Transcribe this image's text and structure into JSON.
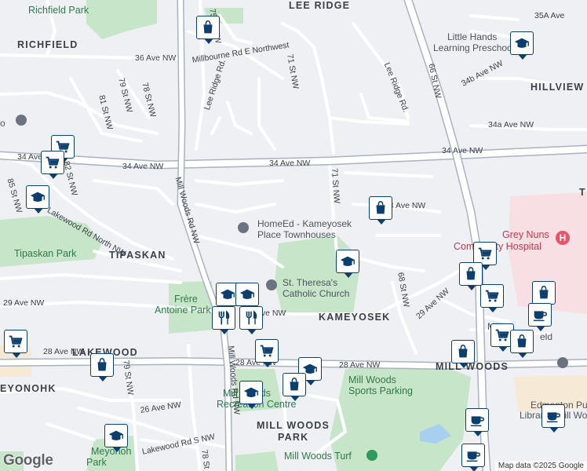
{
  "map": {
    "attribution": "Map data ©2025 Google",
    "logo": "Google",
    "neighbourhoods": [
      "LEE RIDGE",
      "RICHFIELD",
      "HILLVIEW",
      "TIPASKAN",
      "KAMEYOSEK",
      "MILL WOODS",
      "EYONOHK",
      "LAKEWOOD",
      "MILL WOODS",
      "PARK",
      "T"
    ],
    "parks": [
      "Richfield Park",
      "Tipaskan Park",
      "Frère",
      "Antoine Park",
      "Mill Woods",
      "Recreation Centre",
      "Meyonoh",
      "Park",
      "Mill Woods Turf",
      "Mill Woods",
      "Sports Parking"
    ],
    "streets": [
      "35A Ave",
      "36 Ave NW",
      "Millbourne Rd E Northwest",
      "75 St NW",
      "Lee Ridge Rd.",
      "71 St NW",
      "Lee Ridge Rd.",
      "66 St NW",
      "34b Ave NW",
      "34a Ave NW",
      "81 St NW",
      "79 St NW",
      "78 St NW",
      "34 Ave NW",
      "34 Ave NW",
      "34 Ave NW",
      "34 Ave NW",
      "85 St NW",
      "82 St NW",
      "Lakewood Rd North NW",
      "Mill Woods Rd NW",
      "71 St NW",
      "34 Ave NW",
      "68 St NW",
      "29 Ave NW",
      "29 Ave NW",
      "29 Ave NW",
      "28 Ave NW",
      "28 Ave NW",
      "28 Ave NW",
      "79 St NW",
      "26 Ave NW",
      "Lakewood Rd S NW",
      "78 St",
      "Mill Woods Rd NW"
    ],
    "pois": [
      "Little Hands",
      "Learning Preschool",
      "HomeEd - Kameyosek",
      "Place Townhouses",
      "St. Theresa's",
      "Catholic Church",
      "Edmonton Publi",
      "Library - Mill Wood",
      "Millwo",
      "eld",
      "o"
    ],
    "hospital": [
      "Grey Nuns",
      "Community Hospital"
    ],
    "colors": {
      "background": "#eef0f4",
      "park": "#c6e5c9",
      "major_road": "#a8b3bf",
      "hospital": "#f7dfe3",
      "pin_border": "#0c3e6e",
      "park_text": "#2f7a4a",
      "hospital_text": "#c4374d"
    },
    "markers": [
      {
        "icon": "shopping-bag-icon"
      },
      {
        "icon": "school-cap-icon"
      },
      {
        "icon": "shopping-cart-icon"
      },
      {
        "icon": "shopping-cart-icon"
      },
      {
        "icon": "school-cap-icon"
      },
      {
        "icon": "shopping-bag-icon"
      },
      {
        "icon": "school-cap-icon"
      },
      {
        "icon": "shopping-cart-icon"
      },
      {
        "icon": "shopping-bag-icon"
      },
      {
        "icon": "shopping-cart-icon"
      },
      {
        "icon": "shopping-bag-icon"
      },
      {
        "icon": "coffee-cup-icon"
      },
      {
        "icon": "shopping-cart-icon"
      },
      {
        "icon": "shopping-bag-icon"
      },
      {
        "icon": "shopping-cart-icon"
      },
      {
        "icon": "shopping-bag-icon"
      },
      {
        "icon": "school-cap-icon"
      },
      {
        "icon": "school-cap-icon"
      },
      {
        "icon": "restaurant-icon"
      },
      {
        "icon": "restaurant-icon"
      },
      {
        "icon": "shopping-cart-icon"
      },
      {
        "icon": "school-cap-icon"
      },
      {
        "icon": "shopping-bag-icon"
      },
      {
        "icon": "school-cap-icon"
      },
      {
        "icon": "shopping-bag-icon"
      },
      {
        "icon": "coffee-cup-icon"
      },
      {
        "icon": "coffee-cup-icon"
      },
      {
        "icon": "coffee-cup-icon"
      },
      {
        "icon": "school-cap-icon"
      }
    ]
  }
}
